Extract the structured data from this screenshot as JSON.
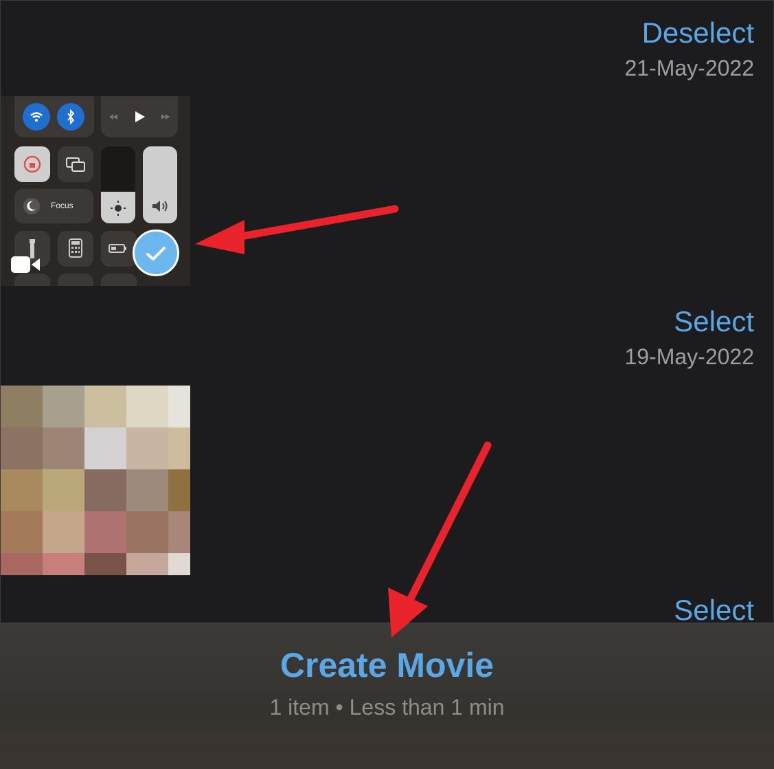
{
  "sections": [
    {
      "action_label": "Deselect",
      "date": "21-May-2022"
    },
    {
      "action_label": "Select",
      "date": "19-May-2022"
    },
    {
      "action_label": "Select"
    }
  ],
  "thumbnail_1": {
    "focus_label": "Focus",
    "selected": true,
    "type_icon": "video-camera-icon",
    "check_icon": "checkmark-icon"
  },
  "pixel_colors": [
    [
      "#8e7f62",
      "#a8a08f",
      "#cbbf9f",
      "#ddd7c4",
      "#e5e3dc"
    ],
    [
      "#8b7262",
      "#9e8474",
      "#d3d1d2",
      "#c9b5a4",
      "#cdbd9e"
    ],
    [
      "#a98a5f",
      "#bba87a",
      "#876b61",
      "#9e8a7d",
      "#8f7040"
    ],
    [
      "#a47b5a",
      "#c6a68b",
      "#ae7270",
      "#9a7462",
      "#a8867a"
    ],
    [
      "#a86760",
      "#c87f7c",
      "#7a5348",
      "#c6a79c",
      "#e1d9d4"
    ]
  ],
  "bottom_bar": {
    "create_label": "Create Movie",
    "summary": "1 item • Less than 1 min"
  },
  "annotation_color": "#e8232b"
}
